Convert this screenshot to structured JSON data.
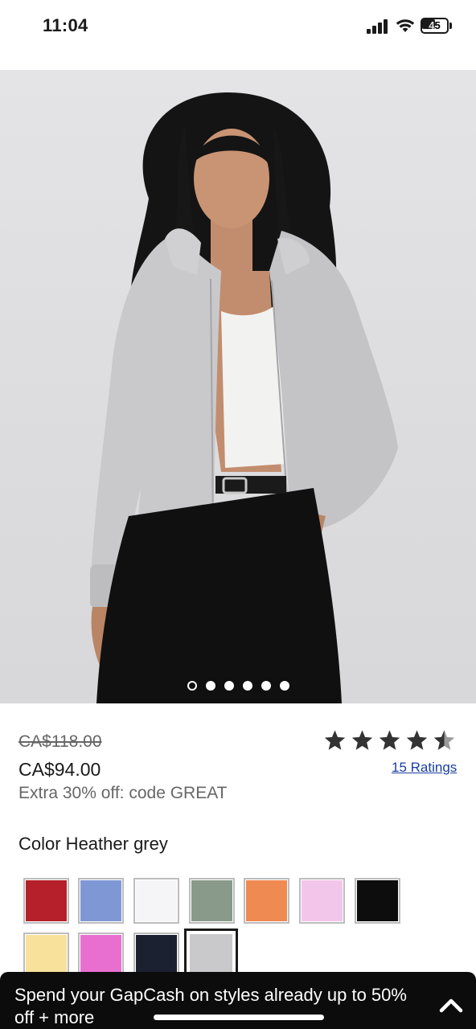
{
  "status_bar": {
    "time": "11:04",
    "battery": "45",
    "icons": [
      "signal-icon",
      "wifi-icon",
      "battery-icon"
    ]
  },
  "product": {
    "image": {
      "carousel_count": 6,
      "active_index": 0
    },
    "price_original": "CA$118.00",
    "price_sale": "CA$94.00",
    "promo": "Extra 30% off: code GREAT",
    "rating": 4.5,
    "rating_max": 5,
    "ratings_link": "15 Ratings",
    "color_label": "Color Heather grey",
    "swatches": [
      {
        "color": "#b5202a"
      },
      {
        "color": "#7f97d4"
      },
      {
        "color": "#f5f5f7"
      },
      {
        "color": "#8a9a8a"
      },
      {
        "color": "#ef8a52"
      },
      {
        "color": "#f2c6ea"
      },
      {
        "color": "#0d0d0d"
      },
      {
        "color": "#f8e19a"
      },
      {
        "color": "#e86fd0"
      },
      {
        "color": "#1b2130"
      },
      {
        "color": "#c9c9cb",
        "selected": true
      }
    ]
  },
  "banner": {
    "text": "Spend your GapCash on styles already up to 50% off + more",
    "icon": "chevron-up-icon"
  }
}
